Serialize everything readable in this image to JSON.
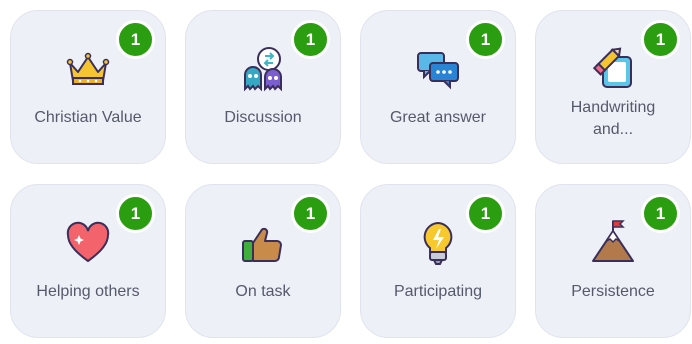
{
  "cards": [
    {
      "label": "Christian Value",
      "count": "1",
      "icon": "crown-icon"
    },
    {
      "label": "Discussion",
      "count": "1",
      "icon": "discussion-monsters-icon"
    },
    {
      "label": "Great answer",
      "count": "1",
      "icon": "chat-bubbles-icon"
    },
    {
      "label": "Handwriting and...",
      "count": "1",
      "icon": "pencil-paper-icon"
    },
    {
      "label": "Helping others",
      "count": "1",
      "icon": "heart-icon"
    },
    {
      "label": "On task",
      "count": "1",
      "icon": "thumbs-up-icon"
    },
    {
      "label": "Participating",
      "count": "1",
      "icon": "lightbulb-icon"
    },
    {
      "label": "Persistence",
      "count": "1",
      "icon": "mountain-flag-icon"
    }
  ],
  "colors": {
    "badge": "#2a9e10",
    "card": "#eef0f7",
    "label": "#555a6b"
  }
}
